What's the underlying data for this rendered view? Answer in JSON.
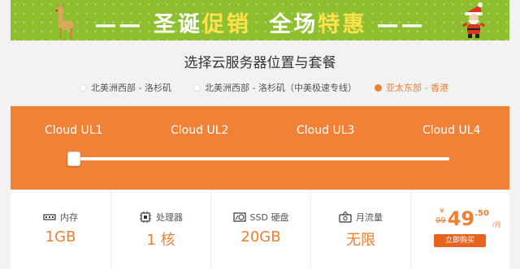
{
  "banner": {
    "left_dash": "——",
    "part1": "圣诞",
    "part2": "促销",
    "part3": "全场",
    "part4": "特惠",
    "right_dash": "——"
  },
  "heading": "选择云服务器位置与套餐",
  "regions": [
    {
      "label": "北美洲西部 - 洛杉矶",
      "active": false
    },
    {
      "label": "北美洲西部 - 洛杉矶（中美极速专线）",
      "active": false
    },
    {
      "label": "亚太东部 - 香港",
      "active": true
    }
  ],
  "plans": [
    "Cloud UL1",
    "Cloud UL2",
    "Cloud UL3",
    "Cloud UL4"
  ],
  "slider": {
    "selected_index": 0
  },
  "specs": [
    {
      "icon": "memory-icon",
      "label": "内存",
      "value": "1GB"
    },
    {
      "icon": "cpu-icon",
      "label": "处理器",
      "value": "1 核"
    },
    {
      "icon": "ssd-icon",
      "label": "SSD 硬盘",
      "value": "20GB"
    },
    {
      "icon": "traffic-icon",
      "label": "月流量",
      "value": "无限"
    }
  ],
  "price": {
    "currency": "¥",
    "old": "99",
    "integer": "49",
    "decimal": ".50",
    "per": "/月",
    "buy_label": "立即购买"
  },
  "colors": {
    "accent": "#f28138",
    "banner_green": "#8dbf2f",
    "highlight_yellow": "#ffe14a"
  }
}
